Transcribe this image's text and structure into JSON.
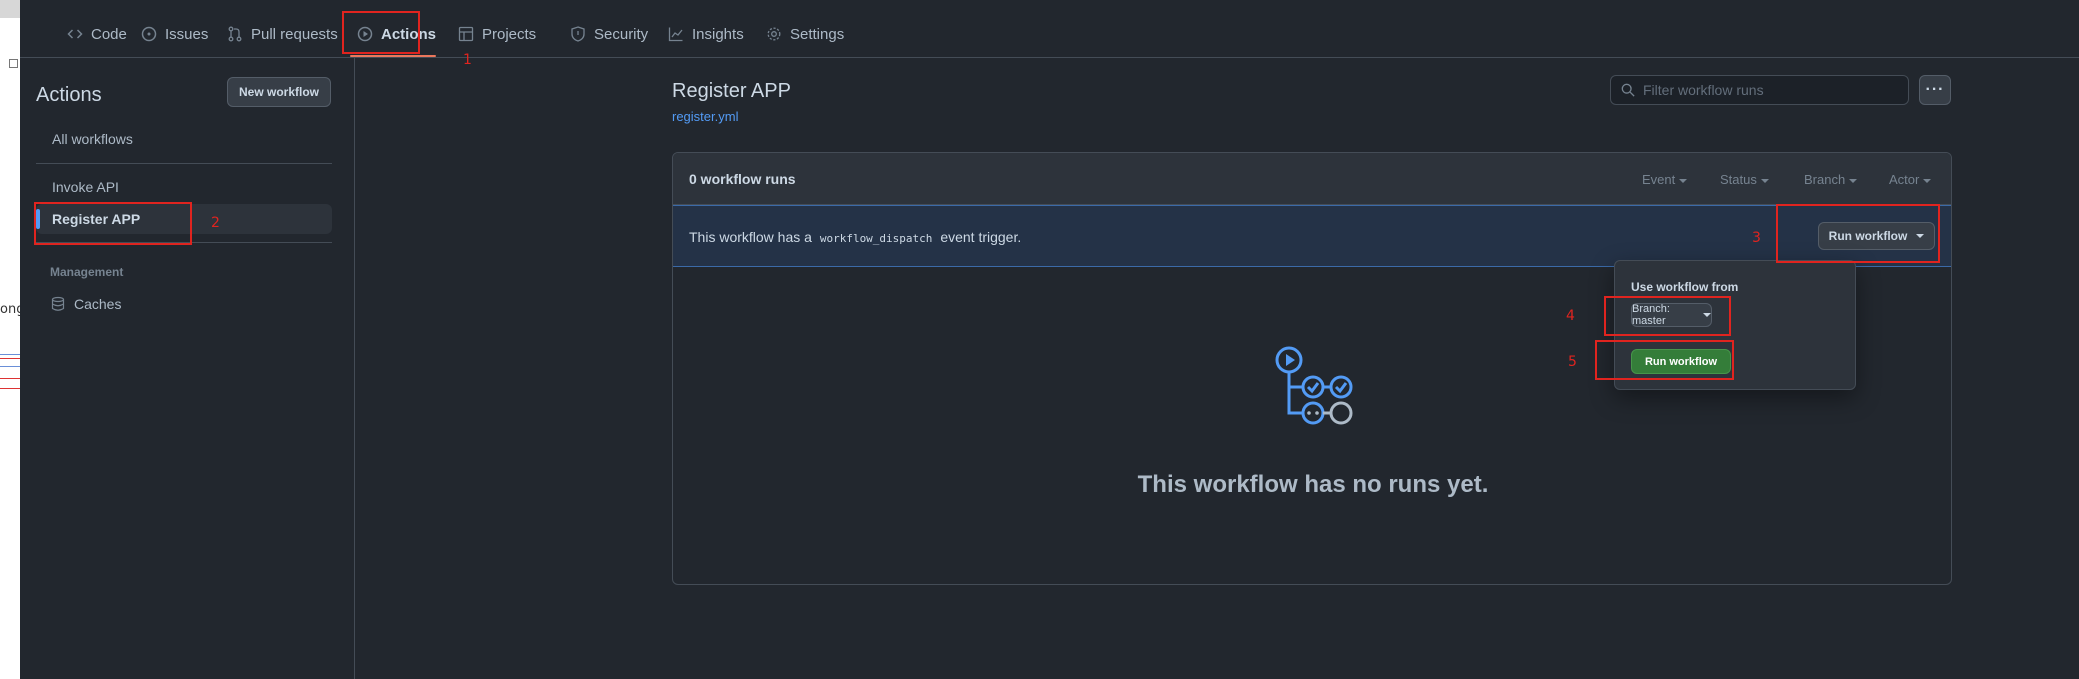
{
  "nav": {
    "tabs": [
      {
        "label": "Code",
        "icon": "code-icon"
      },
      {
        "label": "Issues",
        "icon": "issue-opened-icon"
      },
      {
        "label": "Pull requests",
        "icon": "git-pull-request-icon"
      },
      {
        "label": "Actions",
        "icon": "play-icon",
        "active": true
      },
      {
        "label": "Projects",
        "icon": "table-icon"
      },
      {
        "label": "Security",
        "icon": "shield-icon"
      },
      {
        "label": "Insights",
        "icon": "graph-icon"
      },
      {
        "label": "Settings",
        "icon": "gear-icon"
      }
    ]
  },
  "sidebar": {
    "title": "Actions",
    "new_workflow_label": "New workflow",
    "items": [
      {
        "label": "All workflows"
      },
      {
        "label": "Invoke API"
      },
      {
        "label": "Register APP",
        "active": true
      }
    ],
    "management_heading": "Management",
    "caches_label": "Caches"
  },
  "workflow": {
    "title": "Register APP",
    "file": "register.yml",
    "filter_placeholder": "Filter workflow runs",
    "kebab_label": "···",
    "runs_count": "0 workflow runs",
    "filters": [
      "Event",
      "Status",
      "Branch",
      "Actor"
    ],
    "dispatch_prefix": "This workflow has a",
    "dispatch_code": "workflow_dispatch",
    "dispatch_suffix": "event trigger.",
    "run_workflow_label": "Run workflow",
    "empty_message": "This workflow has no runs yet."
  },
  "popover": {
    "label": "Use workflow from",
    "branch_label": "Branch: master",
    "run_label": "Run workflow"
  },
  "annotations": [
    "1",
    "2",
    "3",
    "4",
    "5"
  ],
  "background_window": {
    "partial_text": "ong"
  },
  "colors": {
    "background": "#22272e",
    "accent_underline": "#ec775c",
    "link": "#539bf5",
    "run_button": "#347d39",
    "annotation": "#e0241f"
  }
}
